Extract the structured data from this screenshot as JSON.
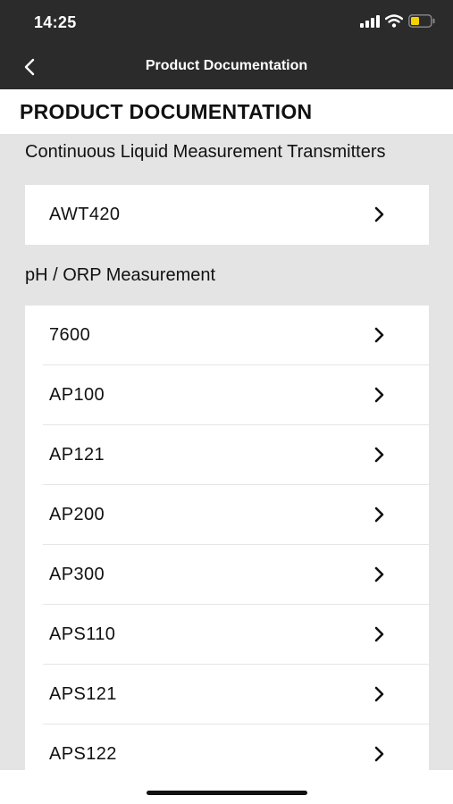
{
  "status_bar": {
    "time": "14:25",
    "icons": [
      "signal-icon",
      "wifi-icon",
      "battery-icon"
    ],
    "battery_color": "#f5d000"
  },
  "nav": {
    "back_icon": "chevron-left-icon",
    "title": "Product Documentation"
  },
  "page": {
    "title": "PRODUCT DOCUMENTATION"
  },
  "sections": [
    {
      "title": "Continuous Liquid Measurement Transmitters",
      "items": [
        {
          "label": "AWT420"
        }
      ]
    },
    {
      "title": "pH / ORP Measurement",
      "items": [
        {
          "label": "7600"
        },
        {
          "label": "AP100"
        },
        {
          "label": "AP121"
        },
        {
          "label": "AP200"
        },
        {
          "label": "AP300"
        },
        {
          "label": "APS110"
        },
        {
          "label": "APS121"
        },
        {
          "label": "APS122"
        }
      ]
    }
  ],
  "colors": {
    "header_background": "#2b2b2b",
    "list_background": "#e4e4e4",
    "card_background": "#ffffff"
  }
}
